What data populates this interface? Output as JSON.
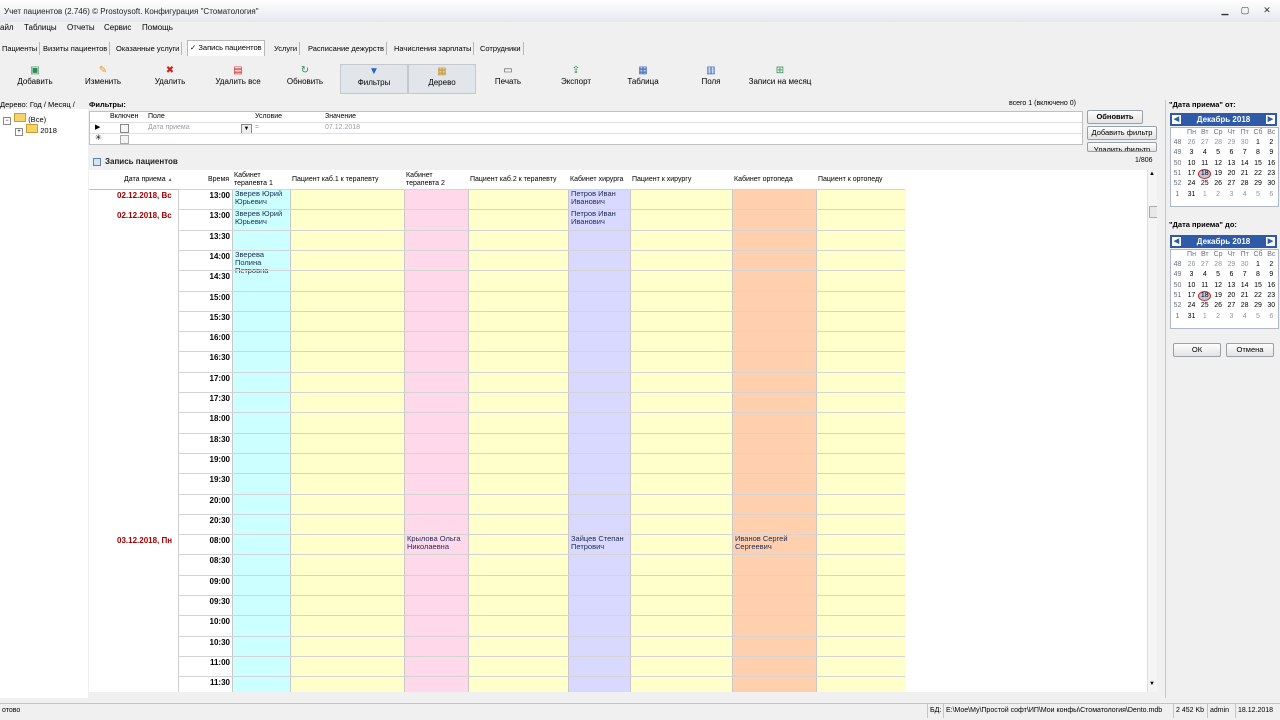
{
  "window": {
    "title": "Учет пациентов (2.746) © Prostoysoft. Конфигурация \"Стоматология\""
  },
  "menu": [
    "айл",
    "Таблицы",
    "Отчеты",
    "Сервис",
    "Помощь"
  ],
  "tabs": [
    {
      "label": "Пациенты"
    },
    {
      "label": "Визиты пациентов"
    },
    {
      "label": "Оказанные услуги"
    },
    {
      "label": "✓ Запись пациентов"
    },
    {
      "label": "Услуги"
    },
    {
      "label": "Расписание дежурств"
    },
    {
      "label": "Начисления зарплаты"
    },
    {
      "label": "Сотрудники"
    }
  ],
  "toolbar": [
    {
      "label": "Добавить",
      "icon": "add-icon"
    },
    {
      "label": "Изменить",
      "icon": "edit-icon"
    },
    {
      "label": "Удалить",
      "icon": "delete-icon"
    },
    {
      "label": "Удалить все",
      "icon": "delete-all-icon"
    },
    {
      "label": "Обновить",
      "icon": "refresh-icon"
    },
    {
      "label": "Фильтры",
      "icon": "filter-icon"
    },
    {
      "label": "Дерево",
      "icon": "tree-icon"
    },
    {
      "label": "Печать",
      "icon": "print-icon"
    },
    {
      "label": "Экспорт",
      "icon": "export-icon"
    },
    {
      "label": "Таблица",
      "icon": "table-icon"
    },
    {
      "label": "Поля",
      "icon": "fields-icon"
    },
    {
      "label": "Записи на месяц",
      "icon": "month-icon"
    }
  ],
  "tree": {
    "header": "Дерево: Год / Месяц /",
    "items": [
      {
        "label": "(Все)"
      },
      {
        "label": "2018"
      }
    ]
  },
  "filters": {
    "title": "Фильтры:",
    "count": "всего 1 (включено 0)",
    "columns": [
      "Включен",
      "Поле",
      "Условие",
      "Значение"
    ],
    "row": {
      "field": "Дата приема",
      "condition": "=",
      "value": "07.12.2018"
    },
    "buttons": {
      "refresh": "Обновить",
      "add": "Добавить фильтр",
      "remove": "Удалить фильтр"
    }
  },
  "main": {
    "title": "Запись пациентов",
    "counter": "1/806",
    "columns": [
      "Дата приема",
      "Время",
      "Кабинет терапевта 1",
      "Пациент каб.1 к терапевту",
      "Кабинет терапевта 2",
      "Пациент каб.2 к терапевту",
      "Кабинет хирурга",
      "Пациент к хирургу",
      "Кабинет ортопеда",
      "Пациент к ортопеду"
    ],
    "sort_indicator": "▲",
    "rows": [
      {
        "date": "02.12.2018, Вс",
        "time": "13:00",
        "ther1": "Зверев Юрий Юрьевич",
        "ther2": "",
        "surg": "Петров Иван Иванович",
        "orth": ""
      },
      {
        "date": "02.12.2018, Вс",
        "time": "13:00",
        "ther1": "Зверев Юрий Юрьевич",
        "ther2": "",
        "surg": "Петров Иван Иванович",
        "orth": ""
      },
      {
        "date": "",
        "time": "13:30",
        "ther1": "",
        "ther2": "",
        "surg": "",
        "orth": ""
      },
      {
        "date": "",
        "time": "14:00",
        "ther1": "Зверева Полина Петровна",
        "ther2": "",
        "surg": "",
        "orth": ""
      },
      {
        "date": "",
        "time": "14:30",
        "ther1": "",
        "ther2": "",
        "surg": "",
        "orth": ""
      },
      {
        "date": "",
        "time": "15:00",
        "ther1": "",
        "ther2": "",
        "surg": "",
        "orth": ""
      },
      {
        "date": "",
        "time": "15:30",
        "ther1": "",
        "ther2": "",
        "surg": "",
        "orth": ""
      },
      {
        "date": "",
        "time": "16:00",
        "ther1": "",
        "ther2": "",
        "surg": "",
        "orth": ""
      },
      {
        "date": "",
        "time": "16:30",
        "ther1": "",
        "ther2": "",
        "surg": "",
        "orth": ""
      },
      {
        "date": "",
        "time": "17:00",
        "ther1": "",
        "ther2": "",
        "surg": "",
        "orth": ""
      },
      {
        "date": "",
        "time": "17:30",
        "ther1": "",
        "ther2": "",
        "surg": "",
        "orth": ""
      },
      {
        "date": "",
        "time": "18:00",
        "ther1": "",
        "ther2": "",
        "surg": "",
        "orth": ""
      },
      {
        "date": "",
        "time": "18:30",
        "ther1": "",
        "ther2": "",
        "surg": "",
        "orth": ""
      },
      {
        "date": "",
        "time": "19:00",
        "ther1": "",
        "ther2": "",
        "surg": "",
        "orth": ""
      },
      {
        "date": "",
        "time": "19:30",
        "ther1": "",
        "ther2": "",
        "surg": "",
        "orth": ""
      },
      {
        "date": "",
        "time": "20:00",
        "ther1": "",
        "ther2": "",
        "surg": "",
        "orth": ""
      },
      {
        "date": "",
        "time": "20:30",
        "ther1": "",
        "ther2": "",
        "surg": "",
        "orth": ""
      },
      {
        "date": "03.12.2018, Пн",
        "time": "08:00",
        "ther1": "",
        "ther2": "Крылова Ольга Николаевна",
        "surg": "Зайцев Степан Петрович",
        "orth": "Иванов Сергей Сергеевич"
      },
      {
        "date": "",
        "time": "08:30",
        "ther1": "",
        "ther2": "",
        "surg": "",
        "orth": ""
      },
      {
        "date": "",
        "time": "09:00",
        "ther1": "",
        "ther2": "",
        "surg": "",
        "orth": ""
      },
      {
        "date": "",
        "time": "09:30",
        "ther1": "",
        "ther2": "",
        "surg": "",
        "orth": ""
      },
      {
        "date": "",
        "time": "10:00",
        "ther1": "",
        "ther2": "",
        "surg": "",
        "orth": ""
      },
      {
        "date": "",
        "time": "10:30",
        "ther1": "",
        "ther2": "",
        "surg": "",
        "orth": ""
      },
      {
        "date": "",
        "time": "11:00",
        "ther1": "",
        "ther2": "",
        "surg": "",
        "orth": ""
      },
      {
        "date": "",
        "time": "11:30",
        "ther1": "",
        "ther2": "",
        "surg": "",
        "orth": ""
      }
    ],
    "colors": {
      "ther1": "#ccffff",
      "ther2": "#ffd9ea",
      "surg": "#d9d9ff",
      "orth": "#ffcfae",
      "patient": "#ffffcc",
      "date": "#a00000"
    }
  },
  "calendar_from": {
    "label": "\"Дата приема\" от:",
    "month": "Декабрь 2018",
    "weekdays": [
      "Пн",
      "Вт",
      "Ср",
      "Чт",
      "Пт",
      "Сб",
      "Вс"
    ],
    "weeks": [
      {
        "wk": "48",
        "days": [
          "26",
          "27",
          "28",
          "29",
          "30",
          "1",
          "2"
        ]
      },
      {
        "wk": "49",
        "days": [
          "3",
          "4",
          "5",
          "6",
          "7",
          "8",
          "9"
        ]
      },
      {
        "wk": "50",
        "days": [
          "10",
          "11",
          "12",
          "13",
          "14",
          "15",
          "16"
        ]
      },
      {
        "wk": "51",
        "days": [
          "17",
          "18",
          "19",
          "20",
          "21",
          "22",
          "23"
        ]
      },
      {
        "wk": "52",
        "days": [
          "24",
          "25",
          "26",
          "27",
          "28",
          "29",
          "30"
        ]
      },
      {
        "wk": "1",
        "days": [
          "31",
          "1",
          "2",
          "3",
          "4",
          "5",
          "6"
        ]
      }
    ],
    "today": "18"
  },
  "calendar_to": {
    "label": "\"Дата приема\" до:",
    "month": "Декабрь 2018",
    "weekdays": [
      "Пн",
      "Вт",
      "Ср",
      "Чт",
      "Пт",
      "Сб",
      "Вс"
    ],
    "weeks": [
      {
        "wk": "48",
        "days": [
          "26",
          "27",
          "28",
          "29",
          "30",
          "1",
          "2"
        ]
      },
      {
        "wk": "49",
        "days": [
          "3",
          "4",
          "5",
          "6",
          "7",
          "8",
          "9"
        ]
      },
      {
        "wk": "50",
        "days": [
          "10",
          "11",
          "12",
          "13",
          "14",
          "15",
          "16"
        ]
      },
      {
        "wk": "51",
        "days": [
          "17",
          "18",
          "19",
          "20",
          "21",
          "22",
          "23"
        ]
      },
      {
        "wk": "52",
        "days": [
          "24",
          "25",
          "26",
          "27",
          "28",
          "29",
          "30"
        ]
      },
      {
        "wk": "1",
        "days": [
          "31",
          "1",
          "2",
          "3",
          "4",
          "5",
          "6"
        ]
      }
    ],
    "today": "18"
  },
  "dialog_buttons": {
    "ok": "ОК",
    "cancel": "Отмена"
  },
  "status": {
    "left": "отово",
    "db_label": "БД:",
    "db_path": "E:\\Moe\\My\\Простой софт\\ИП\\Мои конфы\\Стоматология\\Dento.mdb",
    "size": "2 452 Kb",
    "user": "admin",
    "date": "18.12.2018"
  }
}
